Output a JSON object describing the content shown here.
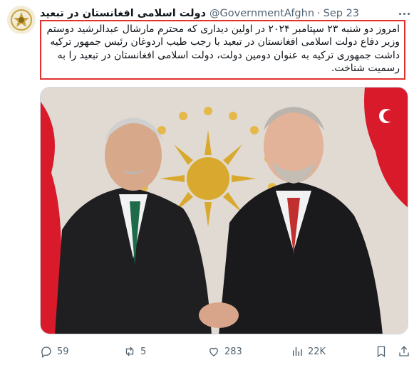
{
  "tweet": {
    "display_name": "دولت اسلامی افغانستان در تبعید",
    "handle": "@GovernmentAfghn",
    "separator": "·",
    "date": "Sep 23",
    "text": "امروز دو شنبه  ۲۳ سپتامبر ۲۰۲۴ در اولین دیداری که محترم مارشال عبدالرشید دوستم وزیر دفاع دولت اسلامی افغانستان در تبعید با رجب طیب اردوغان رئیس جمهور ترکیه داشت جمهوری ترکیه به عنوان دومین دولت،  دولت اسلامی افغانستان در تبعید را به رسمیت شناخت."
  },
  "actions": {
    "replies": "59",
    "retweets": "5",
    "likes": "283",
    "views": "22K"
  },
  "colors": {
    "highlight_border": "#e0312f",
    "muted_text": "#536471",
    "flag_red": "#d91a2a",
    "emblem_gold": "#d8a92e"
  },
  "icons": [
    "more-icon",
    "reply-icon",
    "retweet-icon",
    "like-icon",
    "views-icon",
    "bookmark-icon",
    "share-icon"
  ]
}
